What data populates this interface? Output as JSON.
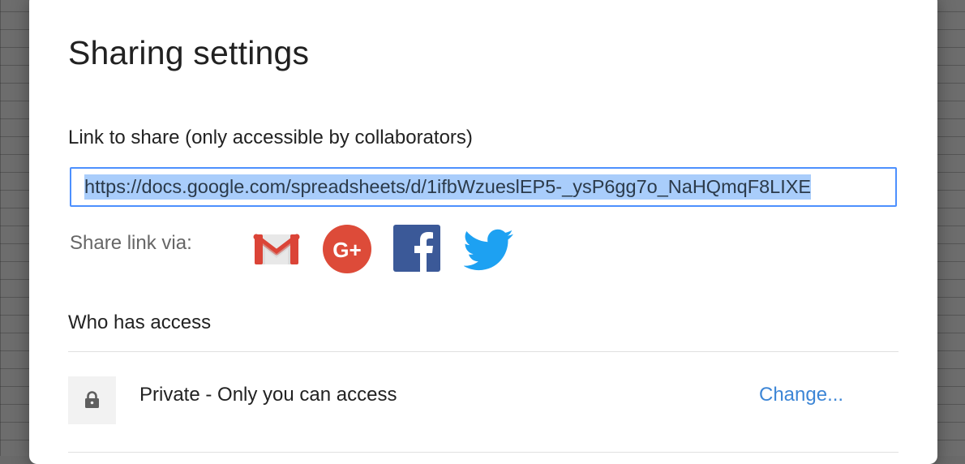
{
  "dialog": {
    "title": "Sharing settings"
  },
  "link": {
    "label": "Link to share (only accessible by collaborators)",
    "value": "https://docs.google.com/spreadsheets/d/1ifbWzueslEP5-_ysP6gg7o_NaHQmqF8LIXE",
    "selected": true,
    "selection_color": "#a9cdfb",
    "border_color": "#4d90fe"
  },
  "share_via": {
    "label": "Share link via:",
    "icons": [
      {
        "name": "gmail-icon",
        "color": "#db4437"
      },
      {
        "name": "google-plus-icon",
        "color": "#dd4b39"
      },
      {
        "name": "facebook-icon",
        "color": "#3b5998"
      },
      {
        "name": "twitter-icon",
        "color": "#1da1f2"
      }
    ]
  },
  "access": {
    "section_title": "Who has access",
    "entries": [
      {
        "icon": "lock-icon",
        "description": "Private - Only you can access",
        "action_label": "Change...",
        "action_color": "#3d86d6"
      }
    ]
  }
}
